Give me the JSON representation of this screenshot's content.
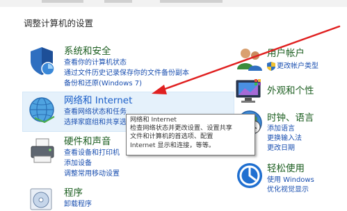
{
  "page": {
    "title": "调整计算机的设置"
  },
  "categories": {
    "system": {
      "title": "系统和安全",
      "links": [
        "查看你的计算机状态",
        "通过文件历史记录保存你的文件备份副本",
        "备份和还原(Windows 7)"
      ]
    },
    "network": {
      "title": "网络和 Internet",
      "links": [
        "查看网络状态和任务",
        "选择家庭组和共享选"
      ]
    },
    "hardware": {
      "title": "硬件和声音",
      "links": [
        "查看设备和打印机",
        "添加设备",
        "调整常用移动设置"
      ]
    },
    "programs": {
      "title": "程序",
      "links": [
        "卸载程序"
      ]
    },
    "user": {
      "title": "用户帐户",
      "links": [
        "更改帐户类型"
      ]
    },
    "appearance": {
      "title": "外观和个性"
    },
    "clock": {
      "title": "时钟、语言",
      "links": [
        "添加语言",
        "更换输入法",
        "更改日期"
      ]
    },
    "access": {
      "title": "轻松使用",
      "links": [
        "使用 Windows",
        "优化视觉显示"
      ]
    }
  },
  "tooltip": {
    "lines": [
      "网络和 Internet",
      "检查网络状态并更改设置、设置共享",
      "文件和计算机的首选项、配置",
      "Internet 显示和连接，等等。"
    ]
  },
  "colors": {
    "category_title": "#1c5e20",
    "category_title_hover": "#1a5ec8",
    "link": "#1a4fb0",
    "arrow": "#e02020",
    "highlight": "#e5f1fb"
  },
  "icons": {
    "system": "shield-icon",
    "network": "globe-network-icon",
    "hardware": "printer-icon",
    "programs": "programs-disc-icon",
    "user": "users-icon",
    "uac": "uac-shield-icon",
    "appearance": "monitor-palette-icon",
    "clock": "clock-globe-icon",
    "access": "accessibility-icon"
  }
}
